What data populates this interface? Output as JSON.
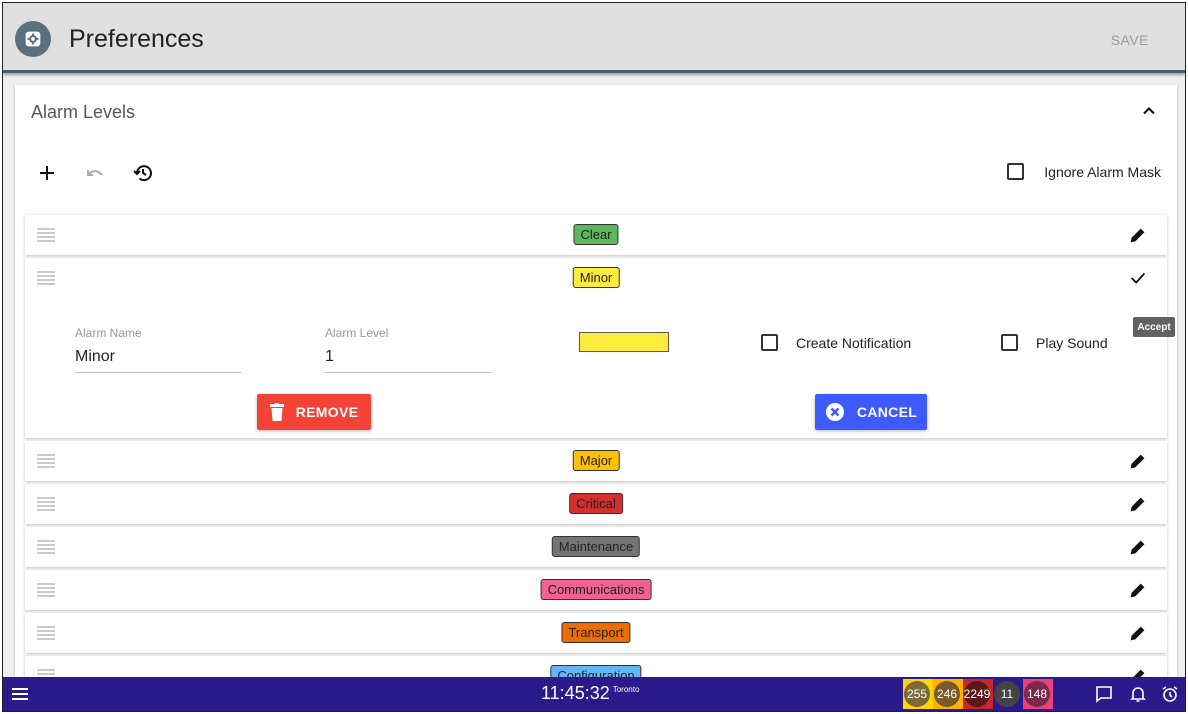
{
  "header": {
    "title": "Preferences",
    "save_label": "SAVE",
    "logo_icon": "gear-icon"
  },
  "panel": {
    "title": "Alarm Levels",
    "toolbar": {
      "add_icon": "plus-icon",
      "undo_icon": "undo-icon",
      "history_icon": "history-icon"
    },
    "ignore_mask_label": "Ignore Alarm Mask",
    "ignore_mask_checked": false
  },
  "alarm_levels": [
    {
      "name": "Clear",
      "color": "#5cb85c"
    },
    {
      "name": "Minor",
      "color": "#ffeb3b"
    },
    {
      "name": "Major",
      "color": "#ffc107"
    },
    {
      "name": "Critical",
      "color": "#d32f2f"
    },
    {
      "name": "Maintenance",
      "color": "#757575"
    },
    {
      "name": "Communications",
      "color": "#f06292"
    },
    {
      "name": "Transport",
      "color": "#ef6c00"
    },
    {
      "name": "Configuration",
      "color": "#64b5f6"
    }
  ],
  "edit_form": {
    "alarm_name_label": "Alarm Name",
    "alarm_name_value": "Minor",
    "alarm_level_label": "Alarm Level",
    "alarm_level_value": "1",
    "swatch_color": "#ffeb3b",
    "create_notification_label": "Create Notification",
    "create_notification_checked": false,
    "play_sound_label": "Play Sound",
    "play_sound_checked": false,
    "remove_label": "REMOVE",
    "cancel_label": "CANCEL",
    "accept_tooltip": "Accept"
  },
  "bottom_bar": {
    "time": "11:45:32",
    "timezone": "Toronto",
    "counts": [
      {
        "value": "255",
        "bg": "#ffd600",
        "circle": "#7a6a3a"
      },
      {
        "value": "246",
        "bg": "#ffb300",
        "circle": "#7a5a2a"
      },
      {
        "value": "2249",
        "bg": "#c62828",
        "circle": "#5a1a1a"
      },
      {
        "value": "11",
        "bg": "#2a1a8c",
        "circle": "#444444"
      },
      {
        "value": "148",
        "bg": "#ec407a",
        "circle": "#7a2a4a"
      }
    ]
  }
}
